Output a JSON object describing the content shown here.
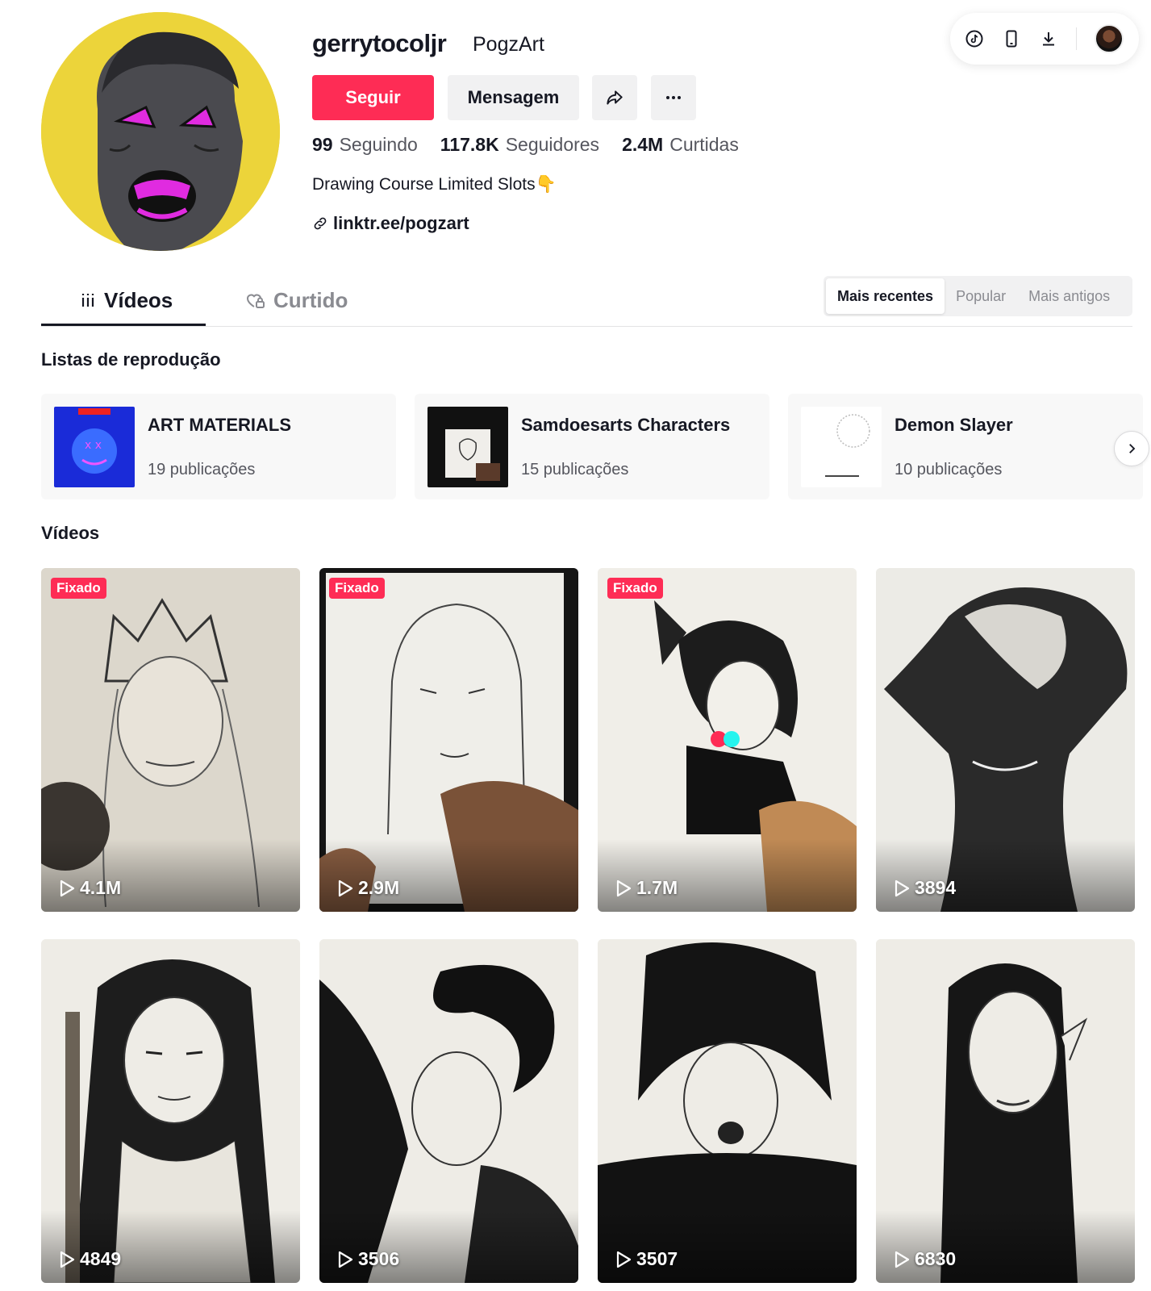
{
  "toolbar": {
    "icons": [
      "tiktok-coin-icon",
      "phone-icon",
      "download-icon",
      "user-avatar"
    ]
  },
  "profile": {
    "username": "gerrytocoljr",
    "nickname": "PogzArt",
    "follow_label": "Seguir",
    "message_label": "Mensagem",
    "stats": {
      "following_count": "99",
      "following_label": "Seguindo",
      "followers_count": "117.8K",
      "followers_label": "Seguidores",
      "likes_count": "2.4M",
      "likes_label": "Curtidas"
    },
    "bio": "Drawing Course Limited Slots👇",
    "link": "linktr.ee/pogzart",
    "colors": {
      "accent": "#fe2c55",
      "avatar_bg": "#ecd43a"
    }
  },
  "tabs": {
    "videos": "Vídeos",
    "liked": "Curtido"
  },
  "sort": {
    "options": [
      "Mais recentes",
      "Popular",
      "Mais antigos"
    ],
    "selected": "Mais recentes"
  },
  "playlists": {
    "title": "Listas de reprodução",
    "items": [
      {
        "title": "ART MATERIALS",
        "count": "19 publicações"
      },
      {
        "title": "Samdoesarts Characters",
        "count": "15 publicações"
      },
      {
        "title": "Demon Slayer",
        "count": "10 publicações"
      }
    ]
  },
  "videos": {
    "title": "Vídeos",
    "pinned_label": "Fixado",
    "items": [
      {
        "views": "4.1M",
        "pinned": true
      },
      {
        "views": "2.9M",
        "pinned": true
      },
      {
        "views": "1.7M",
        "pinned": true
      },
      {
        "views": "3894",
        "pinned": false
      },
      {
        "views": "4849",
        "pinned": false
      },
      {
        "views": "3506",
        "pinned": false
      },
      {
        "views": "3507",
        "pinned": false
      },
      {
        "views": "6830",
        "pinned": false
      }
    ]
  }
}
